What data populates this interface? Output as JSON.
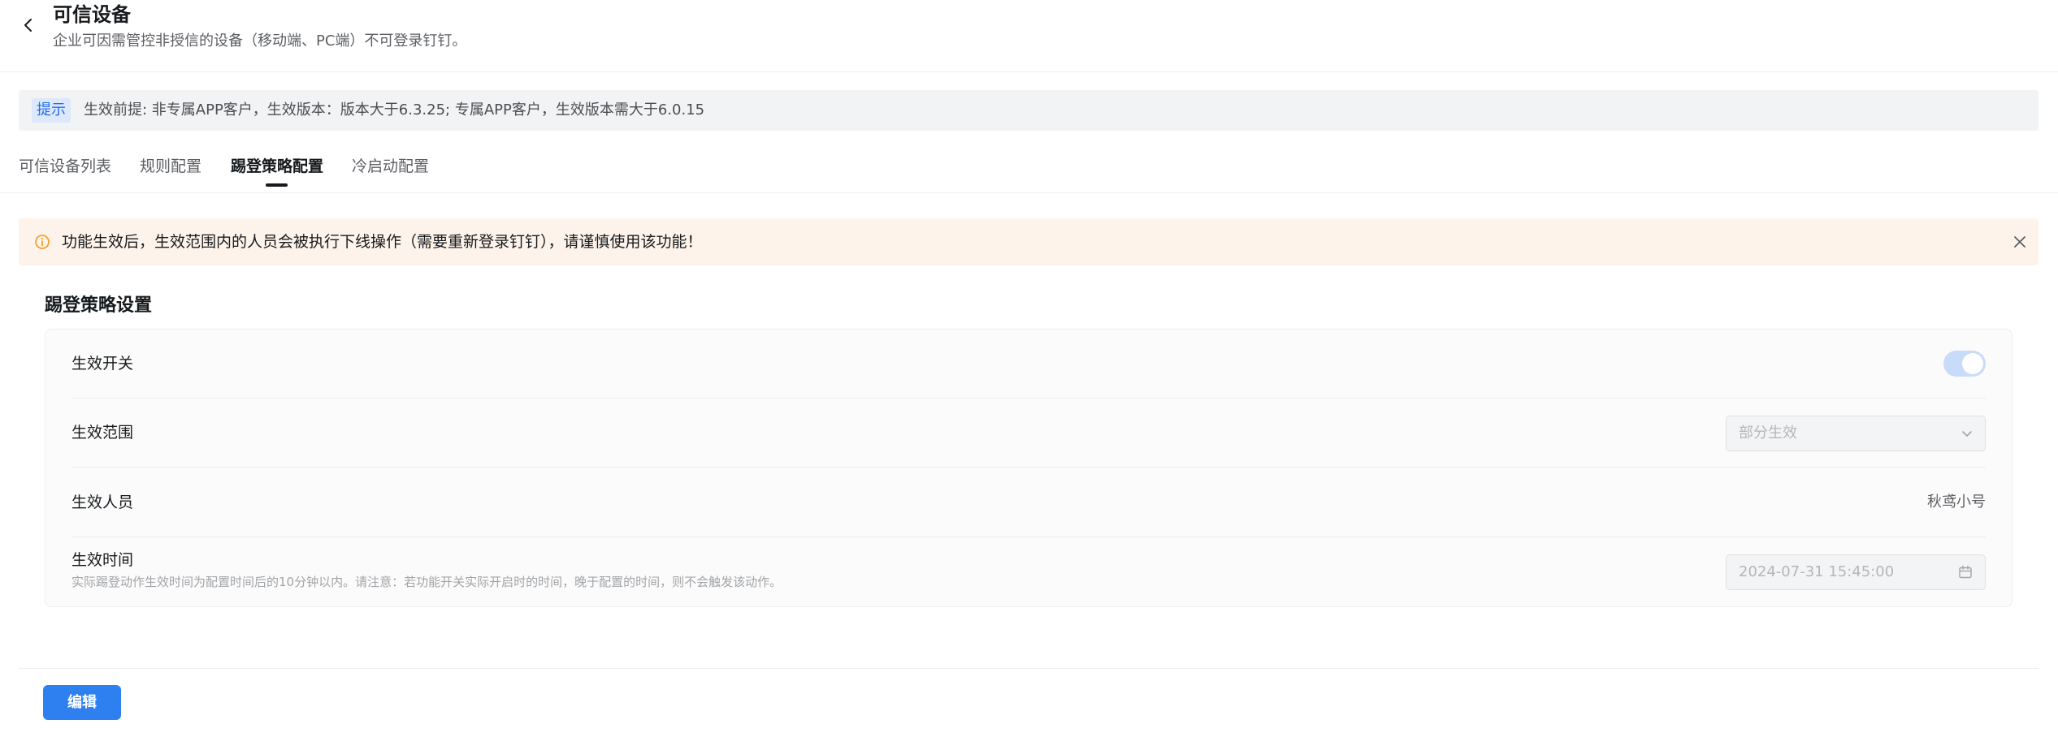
{
  "header": {
    "title": "可信设备",
    "subtitle": "企业可因需管控非授信的设备（移动端、PC端）不可登录钉钉。"
  },
  "notice": {
    "tag": "提示",
    "text": "生效前提: 非专属APP客户，生效版本：版本大于6.3.25; 专属APP客户，生效版本需大于6.0.15"
  },
  "tabs": [
    {
      "label": "可信设备列表",
      "active": false
    },
    {
      "label": "规则配置",
      "active": false
    },
    {
      "label": "踢登策略配置",
      "active": true
    },
    {
      "label": "冷启动配置",
      "active": false
    }
  ],
  "warning": {
    "text": "功能生效后，生效范围内的人员会被执行下线操作（需要重新登录钉钉），请谨慎使用该功能！"
  },
  "section": {
    "title": "踢登策略设置",
    "rows": {
      "switch": {
        "label": "生效开关",
        "enabled": true
      },
      "scope": {
        "label": "生效范围",
        "value": "部分生效"
      },
      "people": {
        "label": "生效人员",
        "value": "秋鸢小号"
      },
      "time": {
        "label": "生效时间",
        "hint": "实际踢登动作生效时间为配置时间后的10分钟以内。请注意：若功能开关实际开启时的时间，晚于配置的时间，则不会触发该动作。",
        "value": "2024-07-31 15:45:00"
      }
    }
  },
  "footer": {
    "edit_label": "编辑"
  },
  "colors": {
    "primary": "#2e7ff0",
    "warning_bg": "#fdf3ea",
    "warning_icon": "#f5a031",
    "notice_bg": "#f2f3f5",
    "switch_on_disabled": "#c8dbf9"
  },
  "icons": {
    "back": "chevron-left-icon",
    "warning": "info-circle-icon",
    "close": "close-icon",
    "select": "chevron-down-icon",
    "date": "calendar-icon"
  }
}
